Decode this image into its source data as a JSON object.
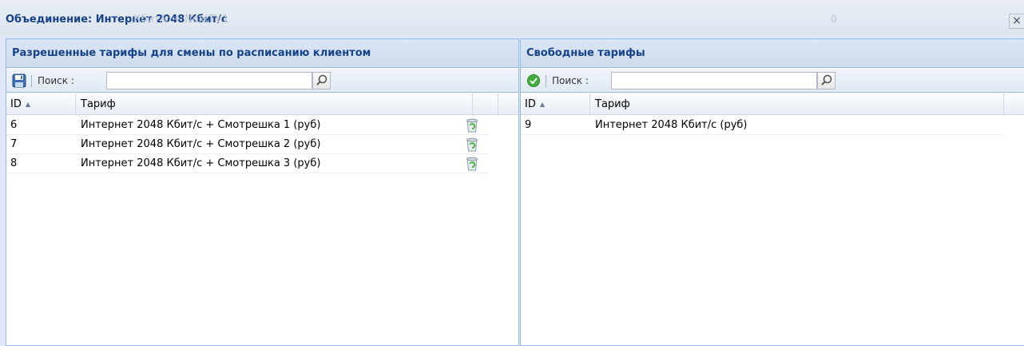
{
  "window": {
    "title": "Объединение: Интернет 2048 Кбит/с",
    "title_ghost": "Кбит/с + NextTV1",
    "title_counter": "0",
    "close_label": "×"
  },
  "left_panel": {
    "header": "Разрешенные тарифы для смены по расписанию клиентом",
    "toolbar": {
      "search_label": "Поиск :",
      "search_value": "",
      "toolbar_icon": "save-icon"
    },
    "columns": {
      "id": "ID",
      "tariff": "Тариф"
    },
    "rows": [
      {
        "id": "6",
        "tariff": "Интернет 2048 Кбит/с + Смотрешка 1 (руб)",
        "action_icon": "recycle-bin-icon"
      },
      {
        "id": "7",
        "tariff": "Интернет 2048 Кбит/с + Смотрешка 2 (руб)",
        "action_icon": "recycle-bin-icon"
      },
      {
        "id": "8",
        "tariff": "Интернет 2048 Кбит/с + Смотрешка 3 (руб)",
        "action_icon": "recycle-bin-icon"
      }
    ]
  },
  "right_panel": {
    "header": "Свободные тарифы",
    "toolbar": {
      "search_label": "Поиск :",
      "search_value": "",
      "toolbar_icon": "accept-icon"
    },
    "columns": {
      "id": "ID",
      "tariff": "Тариф"
    },
    "rows": [
      {
        "id": "9",
        "tariff": "Интернет 2048 Кбит/с (руб)"
      }
    ]
  },
  "colors": {
    "header_text": "#15428b",
    "border": "#99bbe8",
    "accept_green": "#3fae3c"
  }
}
